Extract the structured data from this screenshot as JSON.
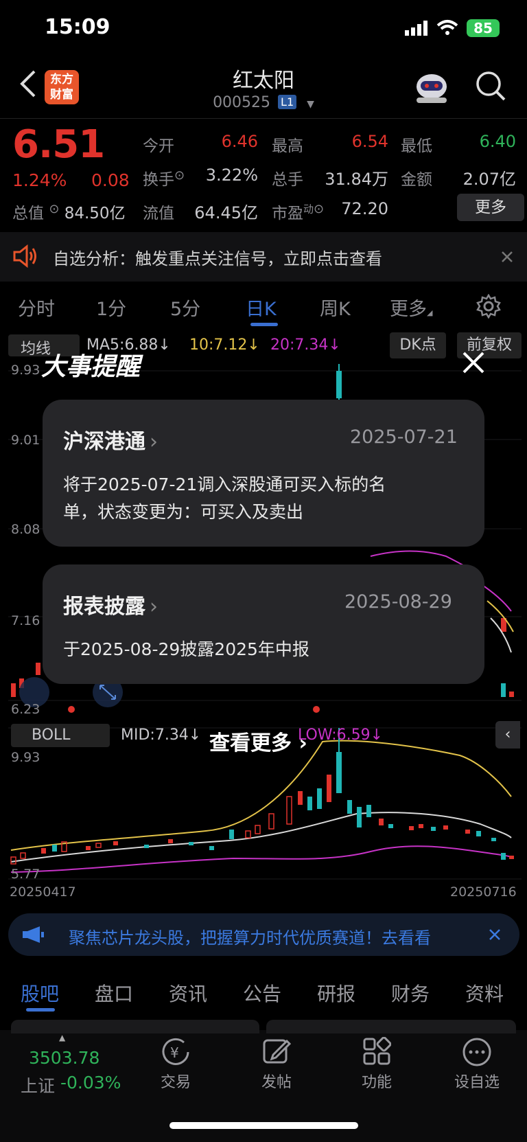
{
  "status_bar": {
    "time": "15:09",
    "battery": "85"
  },
  "header": {
    "logo_text_1": "东方",
    "logo_text_2": "财富",
    "stock_name": "红太阳",
    "stock_code": "000525",
    "level": "L1"
  },
  "quote": {
    "price": "6.51",
    "pct_change": "1.24%",
    "change": "0.08",
    "total_value_label": "总值",
    "total_value": "84.50亿",
    "open_label": "今开",
    "open": "6.46",
    "high_label": "最高",
    "high": "6.54",
    "low_label": "最低",
    "low": "6.40",
    "turnover_label": "换手",
    "turnover": "3.22%",
    "volume_label": "总手",
    "volume": "31.84万",
    "amount_label": "金额",
    "amount": "2.07亿",
    "float_label": "流值",
    "float_value": "64.45亿",
    "pe_label": "市盈",
    "pe_sup": "动",
    "pe": "72.20",
    "more_label": "更多"
  },
  "alert": {
    "text": "自选分析：触发重点关注信号，立即点击查看"
  },
  "period_tabs": [
    "分时",
    "1分",
    "5分",
    "日K",
    "周K",
    "更多"
  ],
  "active_period": "日K",
  "chart": {
    "indicator": "均线",
    "ma5": "MA5:6.88↓",
    "ma10": "10:7.12↓",
    "ma20": "20:7.34↓",
    "dk_label": "DK点",
    "adjust_label": "前复权",
    "y_labels": [
      "9.93",
      "9.01",
      "8.08",
      "7.16",
      "6.23"
    ],
    "sub_indicator": "BOLL",
    "mid": "MID:7.34↓",
    "low": "LOW:6.59↓",
    "sub_y_labels": [
      "9.93",
      "5.77"
    ],
    "date_start": "20250417",
    "date_end": "20250716"
  },
  "modal": {
    "title": "大事提醒",
    "cards": [
      {
        "title": "沪深港通",
        "date": "2025-07-21",
        "body_1": "将于2025-07-21调入深股通可买入标的名",
        "body_2": "单，状态变更为：可买入及卖出"
      },
      {
        "title": "报表披露",
        "date": "2025-08-29",
        "body_1": "于2025-08-29披露2025年中报",
        "body_2": ""
      }
    ],
    "see_more": "查看更多"
  },
  "promo": {
    "text": "聚焦芯片龙头股，把握算力时代优质赛道！去看看"
  },
  "bottom_tabs": [
    "股吧",
    "盘口",
    "资讯",
    "公告",
    "研报",
    "财务",
    "资料"
  ],
  "active_bottom_tab": "股吧",
  "toolbar": {
    "index_value": "3503.78",
    "index_name": "上证",
    "index_change": "-0.03%",
    "trade": "交易",
    "post": "发帖",
    "functions": "功能",
    "watchlist": "设自选"
  },
  "colors": {
    "up": "#e0332c",
    "down": "#2fb35a",
    "accent": "#3a6fd0",
    "ma5": "#d9d9d9",
    "ma10": "#e3c34a",
    "ma20": "#c733c7"
  }
}
